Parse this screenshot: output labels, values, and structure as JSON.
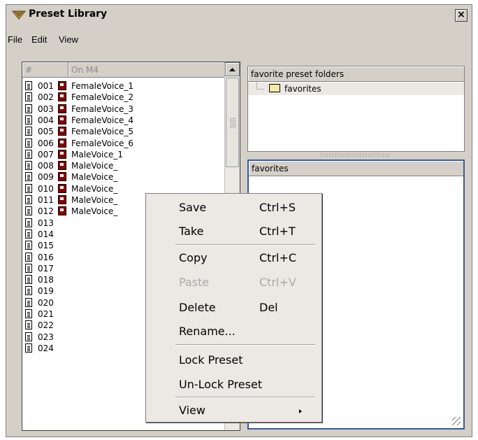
{
  "window": {
    "title": "Preset Library",
    "close_label": "×"
  },
  "menubar": {
    "file": "File",
    "edit": "Edit",
    "view": "View"
  },
  "presets_panel": {
    "col_hash": "#",
    "col_device": "On M4",
    "rows": [
      {
        "num": "001",
        "name": "FemaleVoice_1",
        "locked": true
      },
      {
        "num": "002",
        "name": "FemaleVoice_2",
        "locked": true
      },
      {
        "num": "003",
        "name": "FemaleVoice_3",
        "locked": true
      },
      {
        "num": "004",
        "name": "FemaleVoice_4",
        "locked": true
      },
      {
        "num": "005",
        "name": "FemaleVoice_5",
        "locked": true
      },
      {
        "num": "006",
        "name": "FemaleVoice_6",
        "locked": true
      },
      {
        "num": "007",
        "name": "MaleVoice_1",
        "locked": true
      },
      {
        "num": "008",
        "name": "MaleVoice_",
        "locked": true
      },
      {
        "num": "009",
        "name": "MaleVoice_",
        "locked": true
      },
      {
        "num": "010",
        "name": "MaleVoice_",
        "locked": true
      },
      {
        "num": "011",
        "name": "MaleVoice_",
        "locked": true
      },
      {
        "num": "012",
        "name": "MaleVoice_",
        "locked": true
      },
      {
        "num": "013",
        "name": "",
        "locked": false
      },
      {
        "num": "014",
        "name": "",
        "locked": false
      },
      {
        "num": "015",
        "name": "",
        "locked": false
      },
      {
        "num": "016",
        "name": "",
        "locked": false
      },
      {
        "num": "017",
        "name": "",
        "locked": false
      },
      {
        "num": "018",
        "name": "",
        "locked": false
      },
      {
        "num": "019",
        "name": "",
        "locked": false
      },
      {
        "num": "020",
        "name": "",
        "locked": false
      },
      {
        "num": "021",
        "name": "",
        "locked": false
      },
      {
        "num": "022",
        "name": "",
        "locked": false
      },
      {
        "num": "023",
        "name": "",
        "locked": false
      },
      {
        "num": "024",
        "name": "",
        "locked": false
      }
    ]
  },
  "folders_panel": {
    "header": "favorite preset folders",
    "folder": "favorites"
  },
  "favorites_panel": {
    "header": "favorites"
  },
  "context_menu": {
    "items": [
      {
        "label": "Save",
        "shortcut": "Ctrl+S",
        "disabled": false
      },
      {
        "label": "Take",
        "shortcut": "Ctrl+T",
        "disabled": false
      },
      {
        "label": "Copy",
        "shortcut": "Ctrl+C",
        "disabled": false
      },
      {
        "label": "Paste",
        "shortcut": "Ctrl+V",
        "disabled": true
      },
      {
        "label": "Delete",
        "shortcut": "Del",
        "disabled": false
      },
      {
        "label": "Rename...",
        "shortcut": "",
        "disabled": false
      },
      {
        "label": "Lock Preset",
        "shortcut": "",
        "disabled": false
      },
      {
        "label": "Un-Lock Preset",
        "shortcut": "",
        "disabled": false
      },
      {
        "label": "View",
        "shortcut": "",
        "disabled": false
      }
    ]
  }
}
